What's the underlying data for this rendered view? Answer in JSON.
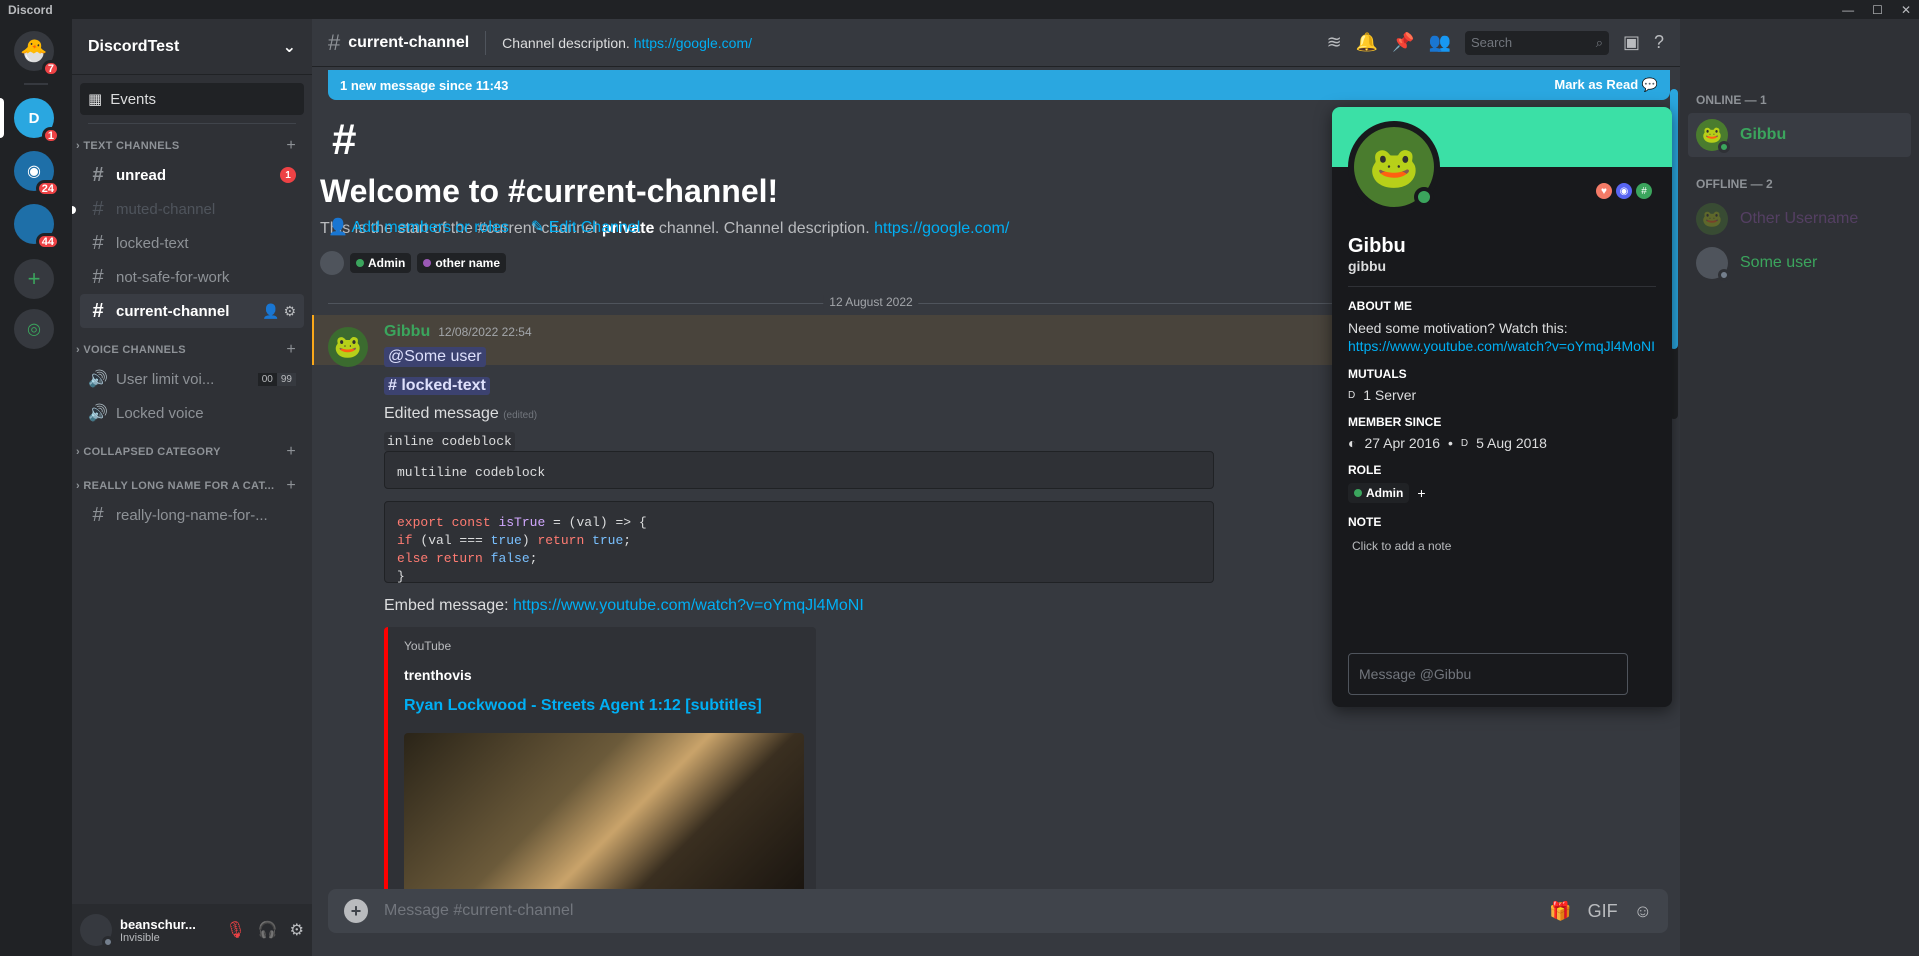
{
  "app": {
    "title": "Discord"
  },
  "servers": [
    {
      "label": "D",
      "badge": "1",
      "color": "#5865f2"
    },
    {
      "label": "",
      "badge": "24",
      "color": "#1e6fa8"
    },
    {
      "label": "",
      "badge": "44",
      "color": "#1e6fa8"
    }
  ],
  "home_badge": "7",
  "guild": {
    "name": "DiscordTest"
  },
  "sidebar": {
    "events_label": "Events",
    "text_category": "TEXT CHANNELS",
    "text_channels": [
      "unread",
      "muted-channel",
      "locked-text",
      "not-safe-for-work",
      "current-channel"
    ],
    "unread_badge": "1",
    "voice_category": "VOICE CHANNELS",
    "voice_channels": [
      "User limit voi...",
      "Locked voice"
    ],
    "voice_limit": [
      "00",
      "99"
    ],
    "collapsed_category": "COLLAPSED CATEGORY",
    "long_category": "REALLY LONG NAME FOR A CAT...",
    "long_channel": "really-long-name-for-..."
  },
  "user": {
    "name": "beanschur...",
    "status": "Invisible"
  },
  "topbar": {
    "channel": "current-channel",
    "description": "Channel description.",
    "link": "https://google.com/",
    "search_placeholder": "Search"
  },
  "newbar": {
    "text": "1 new message since 11:43",
    "action": "Mark as Read"
  },
  "welcome": {
    "title": "Welcome to #current-channel!",
    "text_pre": "This is the start of the #current-channel",
    "text_bold": "private",
    "text_post": "channel. Channel description.",
    "link": "https://google.com/",
    "add_members": "Add members or roles",
    "edit_channel": "Edit Channel",
    "roles": [
      {
        "name": "Admin",
        "color": "#3ba55d"
      },
      {
        "name": "other name",
        "color": "#9b59b6"
      }
    ]
  },
  "date_divider": "12 August 2022",
  "message": {
    "author": "Gibbu",
    "timestamp": "12/08/2022 22:54",
    "mention": "@Some user",
    "channel_mention": "# locked-text",
    "edited_text": "Edited message",
    "edited_tag": "(edited)",
    "inline_code": "inline codeblock",
    "multiline_code": "multiline codeblock",
    "embed_label": "Embed message:",
    "embed_link": "https://www.youtube.com/watch?v=oYmqJl4MoNI",
    "embed_provider": "YouTube",
    "embed_author": "trenthovis",
    "embed_title": "Ryan Lockwood - Streets Agent 1:12 [subtitles]"
  },
  "composer": {
    "placeholder": "Message #current-channel"
  },
  "profile": {
    "name": "Gibbu",
    "username": "gibbu",
    "about_label": "ABOUT ME",
    "about_text": "Need some motivation? Watch this:",
    "about_link": "https://www.youtube.com/watch?v=oYmqJl4MoNI",
    "mutuals_label": "MUTUALS",
    "mutuals_value": "1 Server",
    "member_since_label": "MEMBER SINCE",
    "discord_since": "27 Apr 2016",
    "server_since": "5 Aug 2018",
    "role_label": "ROLE",
    "role": "Admin",
    "note_label": "NOTE",
    "note_placeholder": "Click to add a note",
    "message_placeholder": "Message @Gibbu",
    "banner_color": "#3be0a6"
  },
  "members": {
    "online_label": "ONLINE — 1",
    "offline_label": "OFFLINE — 2",
    "online": [
      "Gibbu"
    ],
    "offline": [
      "Other Username",
      "Some user"
    ]
  }
}
